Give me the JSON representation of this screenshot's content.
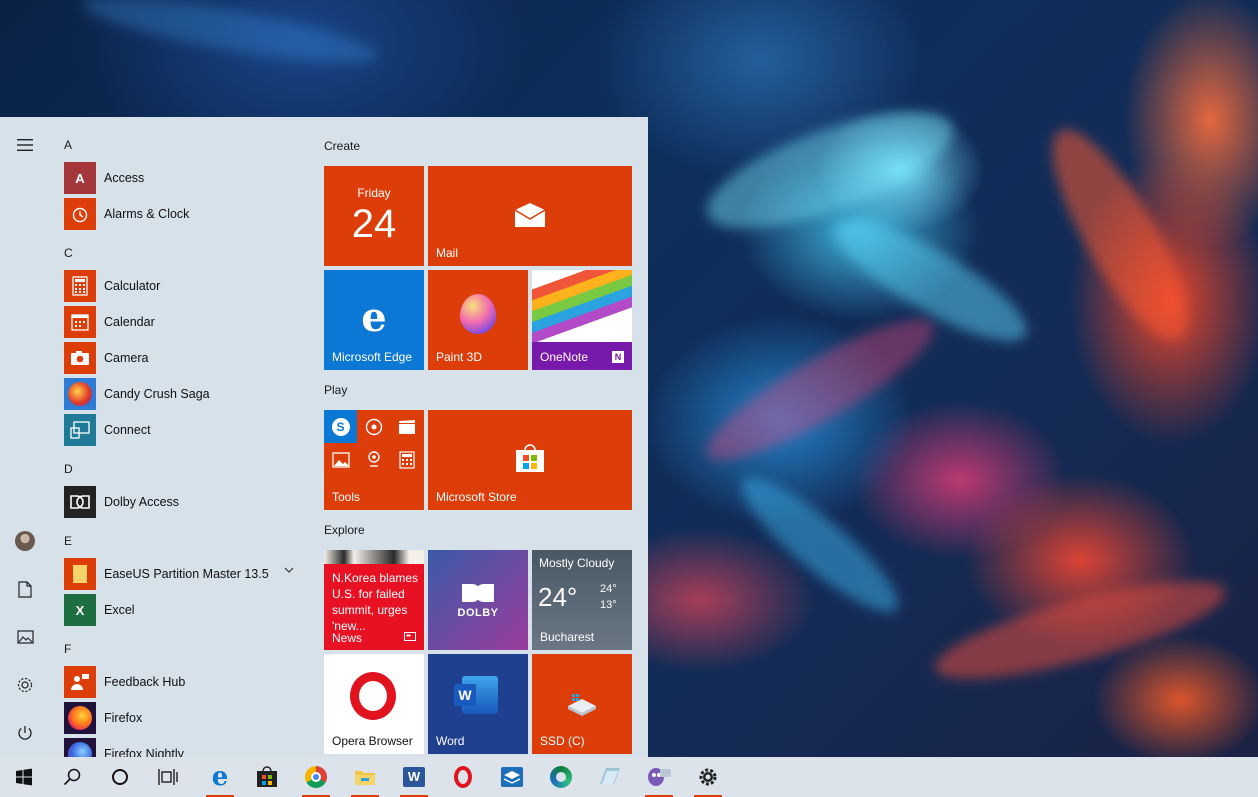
{
  "start_menu": {
    "groups": [
      {
        "letter": "A",
        "apps": [
          "Access",
          "Alarms & Clock"
        ]
      },
      {
        "letter": "C",
        "apps": [
          "Calculator",
          "Calendar",
          "Camera",
          "Candy Crush Saga",
          "Connect"
        ]
      },
      {
        "letter": "D",
        "apps": [
          "Dolby Access"
        ]
      },
      {
        "letter": "E",
        "apps": [
          "EaseUS Partition Master 13.5",
          "Excel"
        ]
      },
      {
        "letter": "F",
        "apps": [
          "Feedback Hub",
          "Firefox",
          "Firefox Nightly"
        ]
      }
    ],
    "tile_groups": {
      "create": "Create",
      "play": "Play",
      "explore": "Explore"
    },
    "tiles": {
      "calendar_day": "Friday",
      "calendar_date": "24",
      "mail": "Mail",
      "edge": "Microsoft Edge",
      "paint3d": "Paint 3D",
      "onenote": "OneNote",
      "tools": "Tools",
      "store": "Microsoft Store",
      "news_headline": "N.Korea blames U.S. for failed summit, urges 'new...",
      "news": "News",
      "dolby": "DOLBY",
      "weather_condition": "Mostly Cloudy",
      "weather_temp": "24°",
      "weather_high": "24°",
      "weather_low": "13°",
      "weather_city": "Bucharest",
      "opera": "Opera Browser",
      "word": "Word",
      "ssd": "SSD (C)"
    }
  },
  "colors": {
    "accent": "#dc3d09",
    "edge_blue": "#0a78d4",
    "onenote_purple": "#7719aa",
    "word_blue": "#1f3f8f",
    "dolby_gradient": [
      "#3b5ba8",
      "#9b3c9e"
    ]
  },
  "taskbar": {
    "items": [
      "start",
      "search",
      "cortana",
      "task-view",
      "edge",
      "store",
      "chrome",
      "file-explorer",
      "word",
      "opera",
      "virtualbox",
      "edge-dev",
      "paint",
      "hexchat",
      "settings"
    ]
  }
}
